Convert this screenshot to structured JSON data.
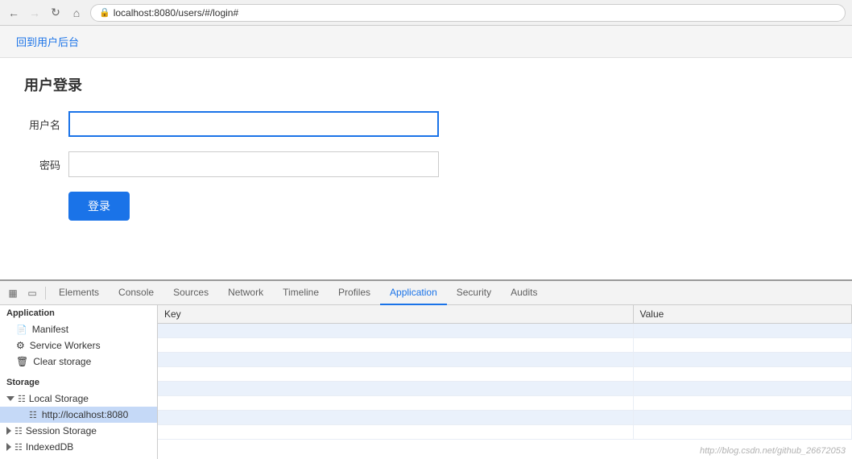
{
  "browser": {
    "url": "localhost:8080/users/#/login#",
    "back_btn": "←",
    "forward_btn": "→",
    "refresh_btn": "↺",
    "home_btn": "⌂"
  },
  "page": {
    "nav_link": "回到用户后台",
    "login_title": "用户登录",
    "username_label": "用户名",
    "password_label": "密码",
    "username_placeholder": "",
    "password_placeholder": "",
    "submit_label": "登录"
  },
  "devtools": {
    "tabs": [
      "Elements",
      "Console",
      "Sources",
      "Network",
      "Timeline",
      "Profiles",
      "Application",
      "Security",
      "Audits"
    ],
    "active_tab": "Application",
    "sidebar": {
      "application_section": "Application",
      "items": [
        {
          "label": "Manifest",
          "icon": "📄"
        },
        {
          "label": "Service Workers",
          "icon": "⚙"
        },
        {
          "label": "Clear storage",
          "icon": "🗑"
        }
      ],
      "storage_section": "Storage",
      "local_storage_label": "Local Storage",
      "local_storage_child": "http://localhost:8080",
      "session_storage_label": "Session Storage",
      "indexed_db_label": "IndexedDB"
    },
    "table": {
      "col_key": "Key",
      "col_value": "Value",
      "rows": [
        {
          "key": "",
          "value": ""
        },
        {
          "key": "",
          "value": ""
        },
        {
          "key": "",
          "value": ""
        },
        {
          "key": "",
          "value": ""
        },
        {
          "key": "",
          "value": ""
        },
        {
          "key": "",
          "value": ""
        },
        {
          "key": "",
          "value": ""
        },
        {
          "key": "",
          "value": ""
        }
      ]
    },
    "watermark": "http://blog.csdn.net/github_26672053"
  }
}
